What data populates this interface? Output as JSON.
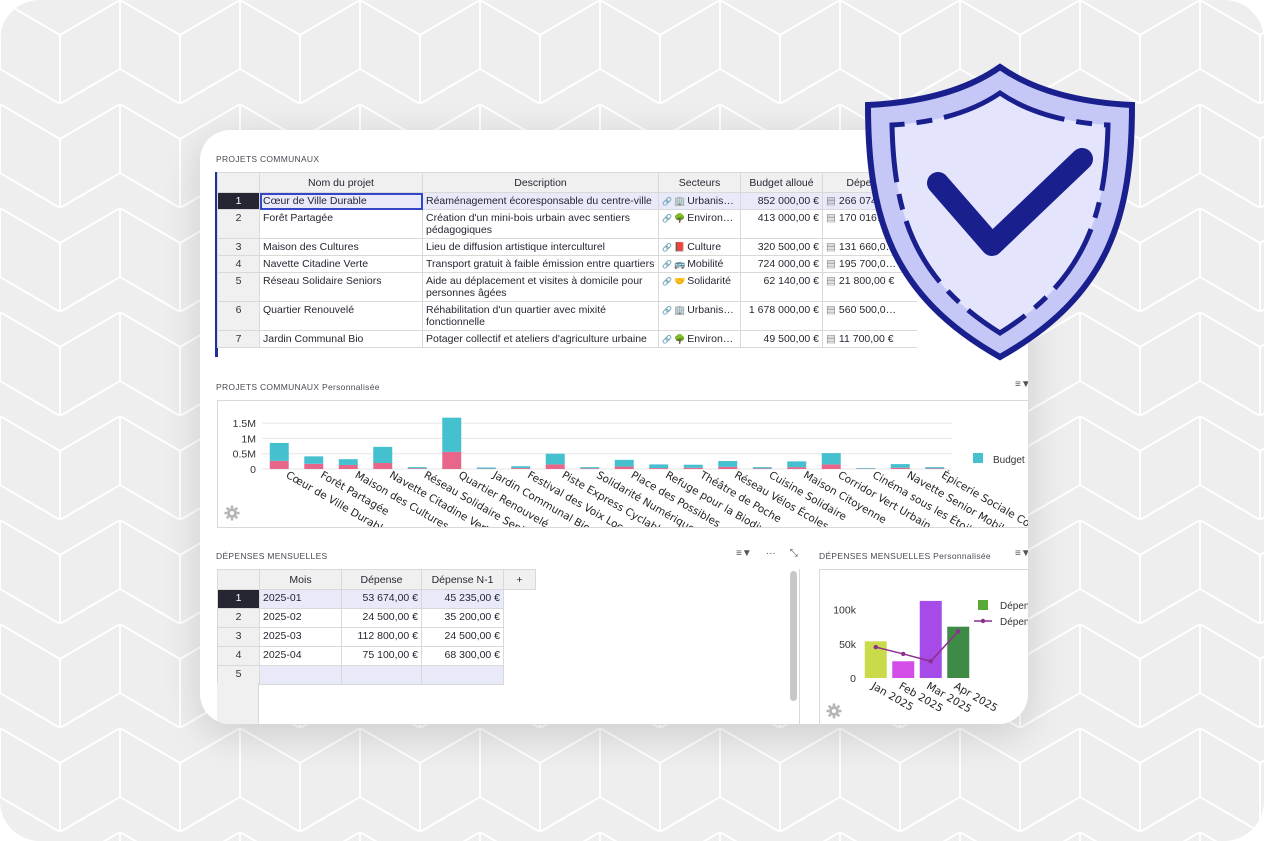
{
  "projects": {
    "title": "PROJETS COMMUNAUX",
    "columns": [
      "",
      "Nom du projet",
      "Description",
      "Secteurs",
      "Budget alloué",
      "Dépenses"
    ],
    "rows": [
      {
        "n": "1",
        "name": "Cœur de Ville Durable",
        "desc": "Réaménagement écoresponsable du centre-ville",
        "sector_icon": "🏢",
        "sector": "Urbanis…",
        "budget": "852 000,00 €",
        "dep": "266 074…"
      },
      {
        "n": "2",
        "name": "Forêt Partagée",
        "desc": "Création d'un mini-bois urbain avec sentiers pédagogiques",
        "sector_icon": "🌳",
        "sector": "Environ…",
        "budget": "413 000,00 €",
        "dep": "170 016…"
      },
      {
        "n": "3",
        "name": "Maison des Cultures",
        "desc": "Lieu de diffusion artistique interculturel",
        "sector_icon": "📕",
        "sector": "Culture",
        "budget": "320 500,00 €",
        "dep": "131 660,0…"
      },
      {
        "n": "4",
        "name": "Navette Citadine Verte",
        "desc": "Transport gratuit à faible émission entre quartiers",
        "sector_icon": "🚌",
        "sector": "Mobilité",
        "budget": "724 000,00 €",
        "dep": "195 700,0…"
      },
      {
        "n": "5",
        "name": "Réseau Solidaire Seniors",
        "desc": "Aide au déplacement et visites à domicile pour personnes âgées",
        "sector_icon": "🤝",
        "sector": "Solidarité",
        "budget": "62 140,00 €",
        "dep": "21 800,00 €"
      },
      {
        "n": "6",
        "name": "Quartier Renouvelé",
        "desc": "Réhabilitation d'un quartier avec mixité fonctionnelle",
        "sector_icon": "🏢",
        "sector": "Urbanis…",
        "budget": "1 678 000,00 €",
        "dep": "560 500,0…"
      },
      {
        "n": "7",
        "name": "Jardin Communal Bio",
        "desc": "Potager collectif et ateliers d'agriculture urbaine",
        "sector_icon": "🌳",
        "sector": "Environ…",
        "budget": "49 500,00 €",
        "dep": "11 700,00 €"
      }
    ]
  },
  "projects_chart": {
    "title": "PROJETS COMMUNAUX Personnalisée",
    "legend_label": "Budget a"
  },
  "chart_data": [
    {
      "type": "bar",
      "stacked": true,
      "categories": [
        "Cœur de Ville Durable",
        "Forêt Partagée",
        "Maison des Cultures",
        "Navette Citadine Verte",
        "Réseau Solidaire Seniors",
        "Quartier Renouvelé",
        "Jardin Communal Bio",
        "Festival des Voix Locales",
        "Piste Express Cyclable",
        "Solidarité Numérique",
        "Place des Possibles",
        "Refuge pour la Biodiversité",
        "Théâtre de Poche",
        "Réseau Vélos Écoles",
        "Cuisine Solidaire",
        "Maison Citoyenne",
        "Corridor Vert Urbain",
        "Cinéma sous les Étoiles",
        "Navette Senior Mobile",
        "Épicerie Sociale Coopérative"
      ],
      "series": [
        {
          "name": "",
          "color": "#e8668a",
          "values": [
            266074,
            170016,
            131660,
            195700,
            21800,
            560500,
            11700,
            30000,
            150000,
            20000,
            80000,
            30000,
            40000,
            70000,
            20000,
            60000,
            150000,
            10000,
            40000,
            20000
          ]
        },
        {
          "name": "Budget a",
          "color": "#44c0cf",
          "values": [
            585926,
            242984,
            188840,
            528300,
            40340,
            1117500,
            37800,
            60000,
            350000,
            40000,
            220000,
            120000,
            100000,
            190000,
            40000,
            190000,
            370000,
            20000,
            120000,
            40000
          ]
        }
      ],
      "yticks": [
        "0",
        "0.5M",
        "1M",
        "1.5M"
      ],
      "ylim": [
        0,
        1700000
      ]
    },
    {
      "type": "bar+line",
      "categories": [
        "Jan 2025",
        "Feb 2025",
        "Mar 2025",
        "Apr 2025"
      ],
      "bar_colors": [
        "#c9db4a",
        "#d24ee6",
        "#a64be8",
        "#3d8b46"
      ],
      "series": [
        {
          "name": "Dépen",
          "type": "bar",
          "legend_color": "#5aaa3a",
          "values": [
            53674,
            24500,
            112800,
            75100
          ]
        },
        {
          "name": "Dépen",
          "type": "line",
          "color": "#8e2f8e",
          "values": [
            45235,
            35200,
            24500,
            68300
          ]
        }
      ],
      "yticks": [
        "0",
        "50k",
        "100k"
      ],
      "ylim": [
        0,
        120000
      ]
    }
  ],
  "monthly": {
    "title": "DÉPENSES MENSUELLES",
    "columns": [
      "",
      "Mois",
      "Dépense",
      "Dépense N-1",
      "+"
    ],
    "rows": [
      {
        "n": "1",
        "mois": "2025-01",
        "dep": "53 674,00 €",
        "depn1": "45 235,00 €"
      },
      {
        "n": "2",
        "mois": "2025-02",
        "dep": "24 500,00 €",
        "depn1": "35 200,00 €"
      },
      {
        "n": "3",
        "mois": "2025-03",
        "dep": "112 800,00 €",
        "depn1": "24 500,00 €"
      },
      {
        "n": "4",
        "mois": "2025-04",
        "dep": "75 100,00 €",
        "depn1": "68 300,00 €"
      },
      {
        "n": "5",
        "mois": "",
        "dep": "",
        "depn1": ""
      }
    ],
    "tools": {
      "filter": "≡▼",
      "more": "···",
      "expand": "⤡"
    }
  },
  "monthly_chart": {
    "title": "DÉPENSES MENSUELLES Personnalisée"
  },
  "icons": {
    "link": "🔗",
    "card": "▤",
    "filter": "≡▼",
    "gear": "gear-icon",
    "shield": "shield-check-icon"
  },
  "colors": {
    "accent": "#1f2f9a",
    "shield_fill": "#c5c8f7",
    "shield_inner": "#e4e5fc",
    "shield_dark": "#1a1f8e"
  }
}
